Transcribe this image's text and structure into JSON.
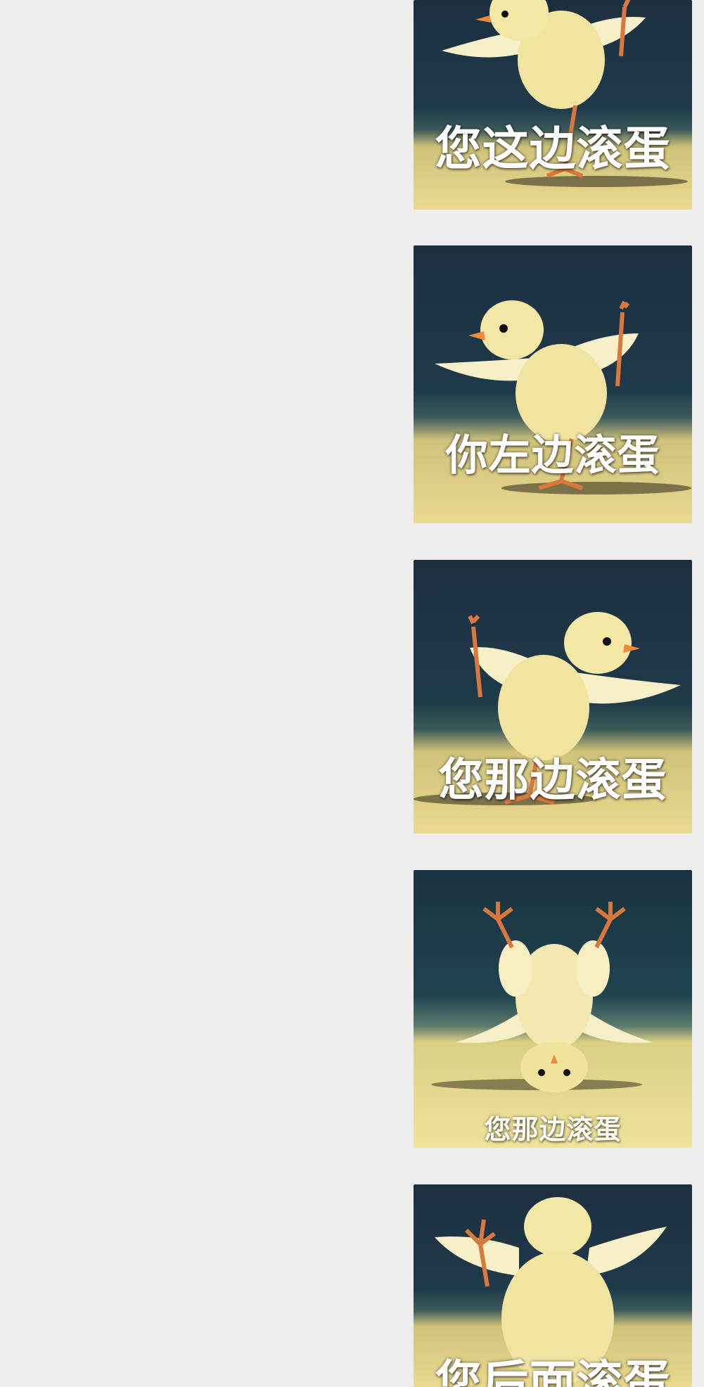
{
  "feed": {
    "stickers": [
      {
        "caption": "您这边滚蛋",
        "icon": "yoga-chick-facing-left"
      },
      {
        "caption": "你左边滚蛋",
        "icon": "yoga-chick-facing-left"
      },
      {
        "caption": "您那边滚蛋",
        "icon": "yoga-chick-facing-right"
      },
      {
        "caption": "您那边滚蛋",
        "icon": "yoga-chick-headstand"
      },
      {
        "caption": "您后面滚蛋",
        "icon": "yoga-chick-back-view"
      }
    ]
  },
  "colors": {
    "background": "#ededed",
    "caption_text": "#ffffff",
    "chick_body": "#f3e7a6",
    "chick_beak": "#f08a3a",
    "chick_legs": "#d9783c"
  }
}
